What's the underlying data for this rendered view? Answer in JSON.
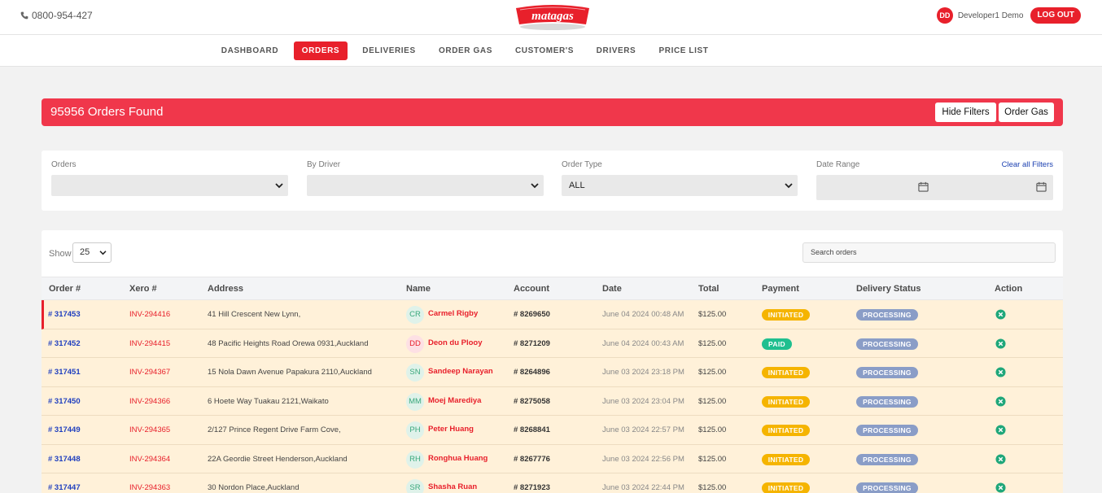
{
  "header": {
    "phone": "0800-954-427",
    "logo_text": "matagas",
    "user_initials": "DD",
    "user_name": "Developer1 Demo",
    "logout_label": "LOG OUT"
  },
  "nav": [
    {
      "label": "DASHBOARD",
      "active": false
    },
    {
      "label": "ORDERS",
      "active": true
    },
    {
      "label": "DELIVERIES",
      "active": false
    },
    {
      "label": "ORDER GAS",
      "active": false
    },
    {
      "label": "CUSTOMER'S",
      "active": false
    },
    {
      "label": "DRIVERS",
      "active": false
    },
    {
      "label": "PRICE LIST",
      "active": false
    }
  ],
  "banner": {
    "title": "95956 Orders Found",
    "hide_filters_label": "Hide Filters",
    "order_gas_label": "Order Gas"
  },
  "filters": {
    "orders_label": "Orders",
    "orders_value": "",
    "driver_label": "By Driver",
    "driver_value": "",
    "type_label": "Order Type",
    "type_value": "ALL",
    "date_label": "Date Range",
    "clear_label": "Clear all Filters"
  },
  "table_controls": {
    "show_label": "Show",
    "show_value": "25",
    "search_placeholder": "Search orders"
  },
  "columns": [
    "Order #",
    "Xero #",
    "Address",
    "Name",
    "Account",
    "Date",
    "Total",
    "Payment",
    "Delivery Status",
    "Action"
  ],
  "rows": [
    {
      "order": "# 317453",
      "xero": "INV-294416",
      "address": "41 Hill Crescent New Lynn,",
      "initials": "CR",
      "name": "Carmel Rigby",
      "account": "# 8269650",
      "date": "June 04 2024 00:48 AM",
      "total": "$125.00",
      "payment": "INITIATED",
      "status": "PROCESSING"
    },
    {
      "order": "# 317452",
      "xero": "INV-294415",
      "address": "48 Pacific Heights Road Orewa 0931,Auckland",
      "initials": "DD",
      "name": "Deon du Plooy",
      "account": "# 8271209",
      "date": "June 04 2024 00:43 AM",
      "total": "$125.00",
      "payment": "PAID",
      "status": "PROCESSING"
    },
    {
      "order": "# 317451",
      "xero": "INV-294367",
      "address": "15 Nola Dawn Avenue Papakura 2110,Auckland",
      "initials": "SN",
      "name": "Sandeep Narayan",
      "account": "# 8264896",
      "date": "June 03 2024 23:18 PM",
      "total": "$125.00",
      "payment": "INITIATED",
      "status": "PROCESSING"
    },
    {
      "order": "# 317450",
      "xero": "INV-294366",
      "address": "6 Hoete Way Tuakau 2121,Waikato",
      "initials": "MM",
      "name": "Moej Marediya",
      "account": "# 8275058",
      "date": "June 03 2024 23:04 PM",
      "total": "$125.00",
      "payment": "INITIATED",
      "status": "PROCESSING"
    },
    {
      "order": "# 317449",
      "xero": "INV-294365",
      "address": "2/127 Prince Regent Drive Farm Cove,",
      "initials": "PH",
      "name": "Peter Huang",
      "account": "# 8268841",
      "date": "June 03 2024 22:57 PM",
      "total": "$125.00",
      "payment": "INITIATED",
      "status": "PROCESSING"
    },
    {
      "order": "# 317448",
      "xero": "INV-294364",
      "address": "22A Geordie Street Henderson,Auckland",
      "initials": "RH",
      "name": "Ronghua Huang",
      "account": "# 8267776",
      "date": "June 03 2024 22:56 PM",
      "total": "$125.00",
      "payment": "INITIATED",
      "status": "PROCESSING"
    },
    {
      "order": "# 317447",
      "xero": "INV-294363",
      "address": "30 Nordon Place,Auckland",
      "initials": "SR",
      "name": "Shasha Ruan",
      "account": "# 8271923",
      "date": "June 03 2024 22:44 PM",
      "total": "$125.00",
      "payment": "INITIATED",
      "status": "PROCESSING"
    }
  ],
  "colors": {
    "brand_red": "#e8202b",
    "banner_red": "#f0374b",
    "row_bg": "#fff1d9",
    "initiated": "#f5b400",
    "paid": "#1fbf8f",
    "processing": "#8a9dc7",
    "action_green": "#1fa77a"
  },
  "icons": [
    "phone-icon",
    "chevron-down-icon",
    "calendar-icon",
    "cancel-circle-icon"
  ]
}
